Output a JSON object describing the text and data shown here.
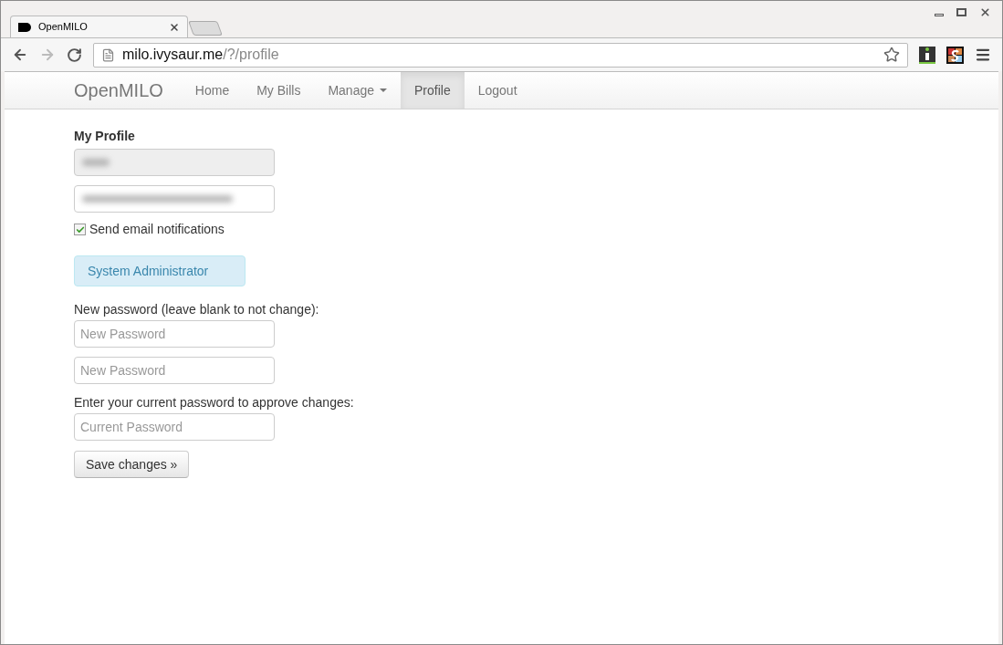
{
  "browser": {
    "tab": {
      "title": "OpenMILO"
    },
    "address": {
      "host": "milo.ivysaur.me",
      "path": "/?/profile"
    }
  },
  "navbar": {
    "brand": "OpenMILO",
    "items": [
      {
        "label": "Home",
        "kind": "link",
        "selected": false
      },
      {
        "label": "My Bills",
        "kind": "link",
        "selected": false
      },
      {
        "label": "Manage",
        "kind": "dropdown",
        "selected": false
      },
      {
        "label": "Profile",
        "kind": "link",
        "selected": true
      },
      {
        "label": "Logout",
        "kind": "link",
        "selected": false
      }
    ]
  },
  "profile": {
    "heading": "My Profile",
    "identity_fields": [
      {
        "disabled": true
      },
      {
        "disabled": false
      }
    ],
    "notifications": {
      "label": "Send email notifications",
      "checked": true
    },
    "role": "System Administrator",
    "new_password_label": "New password (leave blank to not change):",
    "new_password_fields": [
      {
        "placeholder": "New Password"
      },
      {
        "placeholder": "New Password"
      }
    ],
    "current_password_label": "Enter your current password to approve changes:",
    "current_password_field": {
      "placeholder": "Current Password"
    },
    "save_button": "Save changes »"
  }
}
